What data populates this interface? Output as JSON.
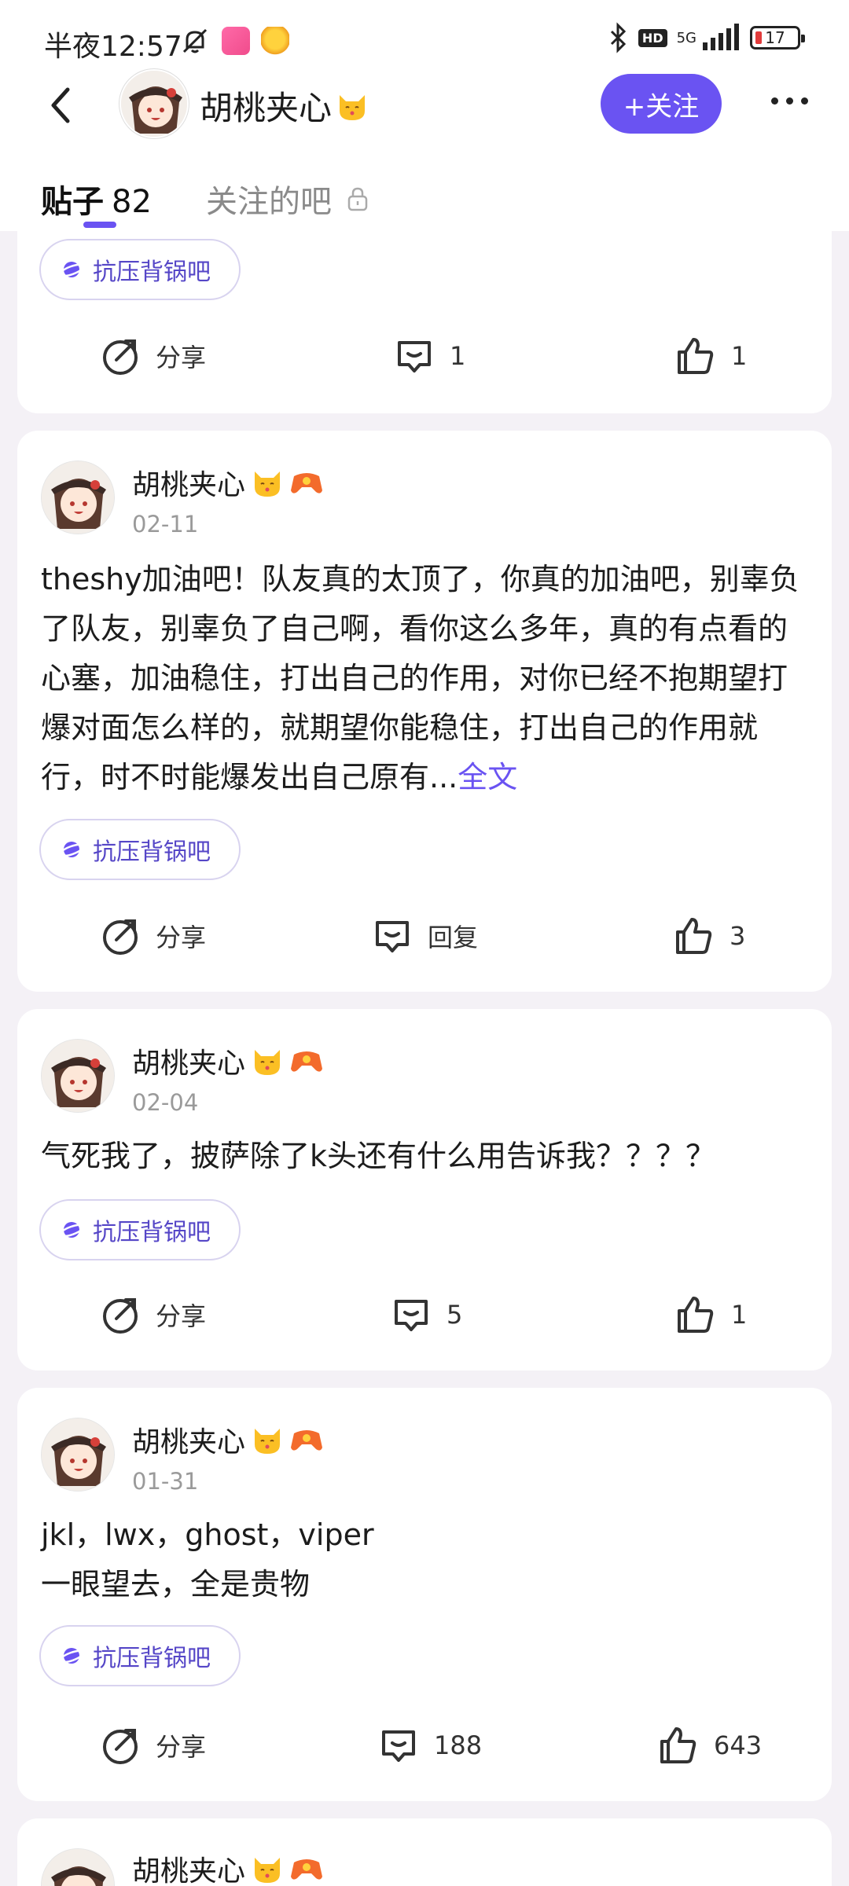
{
  "status_bar": {
    "time": "半夜12:57",
    "network": "5G",
    "hd": "HD",
    "battery": "17"
  },
  "header": {
    "username": "胡桃夹心",
    "follow_label": "+关注"
  },
  "tabs": {
    "posts_label": "贴子",
    "posts_count": "82",
    "followed_label": "关注的吧"
  },
  "posts": [
    {
      "tag": "抗压背锅吧",
      "share": "分享",
      "comments": "1",
      "likes": "1"
    },
    {
      "author": "胡桃夹心",
      "date": "02-11",
      "text": "theshy加油吧！队友真的太顶了，你真的加油吧，别辜负了队友，别辜负了自己啊，看你这么多年，真的有点看的心塞，加油稳住，打出自己的作用，对你已经不抱期望打爆对面怎么样的，就期望你能稳住，打出自己的作用就行，时不时能爆发出自己原有...",
      "more": "全文",
      "tag": "抗压背锅吧",
      "share": "分享",
      "comments": "回复",
      "likes": "3"
    },
    {
      "author": "胡桃夹心",
      "date": "02-04",
      "text": "气死我了，披萨除了k头还有什么用告诉我？？？？",
      "tag": "抗压背锅吧",
      "share": "分享",
      "comments": "5",
      "likes": "1"
    },
    {
      "author": "胡桃夹心",
      "date": "01-31",
      "text_line1": "jkl，lwx，ghost，viper",
      "text_line2": "一眼望去，全是贵物",
      "tag": "抗压背锅吧",
      "share": "分享",
      "comments": "188",
      "likes": "643"
    },
    {
      "author": "胡桃夹心"
    }
  ],
  "colors": {
    "accent": "#6a53f2",
    "background": "#f4f1f6",
    "tag_text": "#5546c7"
  }
}
